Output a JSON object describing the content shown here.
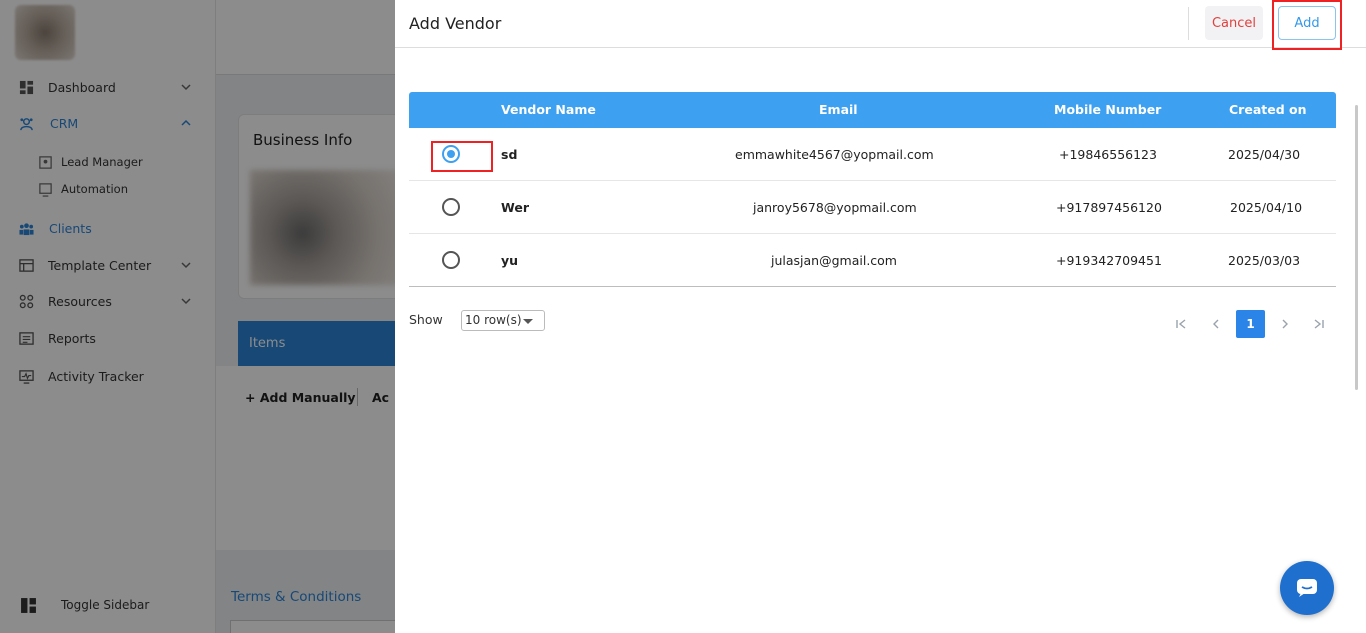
{
  "sidebar": {
    "items": [
      {
        "label": "Dashboard"
      },
      {
        "label": "CRM"
      },
      {
        "label": "Lead Manager"
      },
      {
        "label": "Automation"
      },
      {
        "label": "Clients"
      },
      {
        "label": "Template Center"
      },
      {
        "label": "Resources"
      },
      {
        "label": "Reports"
      },
      {
        "label": "Activity Tracker"
      }
    ],
    "toggle_label": "Toggle Sidebar"
  },
  "background": {
    "business_info_title": "Business Info",
    "items_title": "Items",
    "add_manually": "+ Add Manually",
    "add_other": "Ac",
    "terms_title": "Terms & Conditions"
  },
  "drawer": {
    "title": "Add Vendor",
    "cancel_label": "Cancel",
    "add_label": "Add",
    "columns": [
      "Vendor Name",
      "Email",
      "Mobile Number",
      "Created on"
    ],
    "rows": [
      {
        "name": "sd",
        "email": "emmawhite4567@yopmail.com",
        "mobile": "+19846556123",
        "created": "2025/04/30",
        "selected": true
      },
      {
        "name": "Wer",
        "email": "janroy5678@yopmail.com",
        "mobile": "+917897456120",
        "created": "2025/04/10",
        "selected": false
      },
      {
        "name": "yu",
        "email": "julasjan@gmail.com",
        "mobile": "+919342709451",
        "created": "2025/03/03",
        "selected": false
      }
    ],
    "show_label": "Show",
    "rows_per_page": "10 row(s)",
    "current_page": "1",
    "pager_icons": [
      "first-page-icon",
      "prev-page-icon",
      "next-page-icon",
      "last-page-icon"
    ]
  },
  "colors": {
    "accent": "#3ea0f0",
    "brand_blue": "#2b84d8",
    "cancel_red": "#e0413d",
    "highlight_red": "#ee2222"
  }
}
